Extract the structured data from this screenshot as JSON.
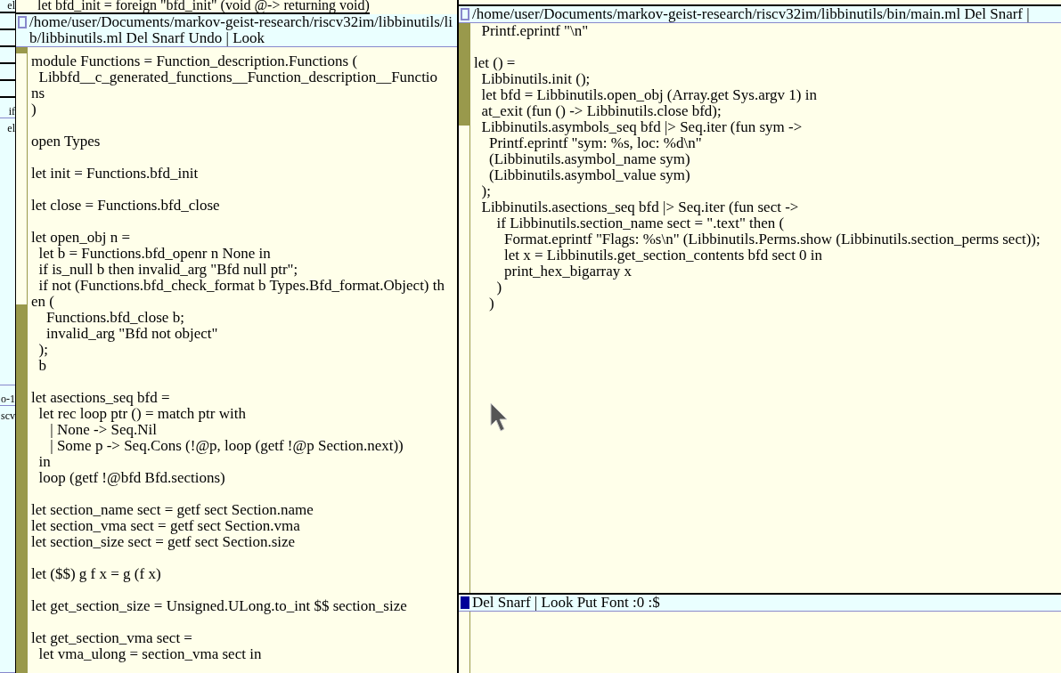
{
  "left_column": {
    "windows": [
      {
        "tag": "el"
      },
      {
        "tag": "if",
        "body": "el"
      },
      {
        "tag": "o-1",
        "body": "scv"
      }
    ]
  },
  "middle_column": {
    "windows": [
      {
        "top_line": "  let bfd_init = foreign \"bfd_init\" (void @-> returning void)",
        "tag": "/home/user/Documents/markov-geist-research/riscv32im/libbinutils/lib/libbinutils.ml Del Snarf Undo | Look",
        "modified": false,
        "body": "module Functions = Function_description.Functions (\n  Libbfd__c_generated_functions__Function_description__Functio\nns\n)\n\nopen Types\n\nlet init = Functions.bfd_init\n\nlet close = Functions.bfd_close\n\nlet open_obj n =\n  let b = Functions.bfd_openr n None in\n  if is_null b then invalid_arg \"Bfd null ptr\";\n  if not (Functions.bfd_check_format b Types.Bfd_format.Object) th\nen (\n    Functions.bfd_close b;\n    invalid_arg \"Bfd not object\"\n  );\n  b\n\nlet asections_seq bfd =\n  let rec loop ptr () = match ptr with\n     | None -> Seq.Nil\n     | Some p -> Seq.Cons (!@p, loop (getf !@p Section.next))\n  in\n  loop (getf !@bfd Bfd.sections)\n\nlet section_name sect = getf sect Section.name\nlet section_vma sect = getf sect Section.vma\nlet section_size sect = getf sect Section.size\n\nlet ($$) g f x = g (f x)\n\nlet get_section_size = Unsigned.ULong.to_int $$ section_size\n\nlet get_section_vma sect =\n  let vma_ulong = section_vma sect in"
      }
    ]
  },
  "right_column": {
    "windows": [
      {
        "tag": "/home/user/Documents/markov-geist-research/riscv32im/libbinutils/bin/main.ml Del Snarf |",
        "modified": false,
        "body": "  Printf.eprintf \"\\n\"\n\nlet () =\n  Libbinutils.init ();\n  let bfd = Libbinutils.open_obj (Array.get Sys.argv 1) in\n  at_exit (fun () -> Libbinutils.close bfd);\n  Libbinutils.asymbols_seq bfd |> Seq.iter (fun sym ->\n    Printf.eprintf \"sym: %s, loc: %d\\n\"\n    (Libbinutils.asymbol_name sym)\n    (Libbinutils.asymbol_value sym)\n  );\n  Libbinutils.asections_seq bfd |> Seq.iter (fun sect ->\n      if Libbinutils.section_name sect = \".text\" then (\n        Format.eprintf \"Flags: %s\\n\" (Libbinutils.Perms.show (Libbinutils.section_perms sect));\n        let x = Libbinutils.get_section_contents bfd sect 0 in\n        print_hex_bigarray x\n      )\n    )"
      },
      {
        "tag": "Del Snarf | Look Put Font :0 :$",
        "modified": true
      }
    ]
  }
}
